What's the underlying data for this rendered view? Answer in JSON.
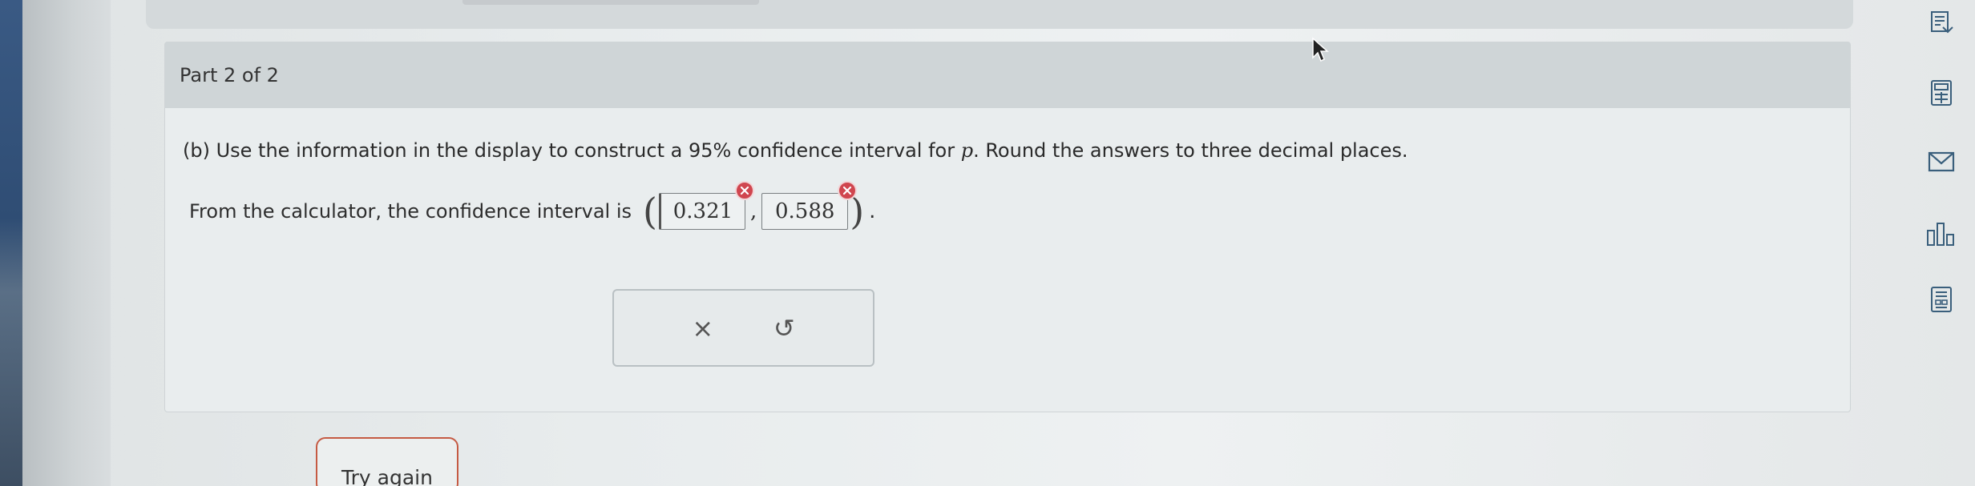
{
  "card": {
    "part_label": "Part 2 of 2",
    "question_prefix": "(b) Use the information in the display to construct a 95% confidence interval for ",
    "question_var": "p",
    "question_suffix": ". Round the answers to three decimal places.",
    "interval_prefix": "From the calculator, the confidence interval is",
    "answers": [
      {
        "value": "0.321",
        "status": "incorrect"
      },
      {
        "value": "0.588",
        "status": "incorrect"
      }
    ],
    "comma": ",",
    "period": ".",
    "clear_glyph": "×",
    "undo_glyph": "↺"
  },
  "footer": {
    "try_again_label": "Try again"
  },
  "rail": {
    "icons": [
      "readout-icon",
      "calculator-icon",
      "mail-icon",
      "chart-icon",
      "reference-sheet-icon"
    ]
  },
  "colors": {
    "error": "#d0464f",
    "try_again_border": "#c55a43",
    "header_bg": "#cfd5d7"
  }
}
